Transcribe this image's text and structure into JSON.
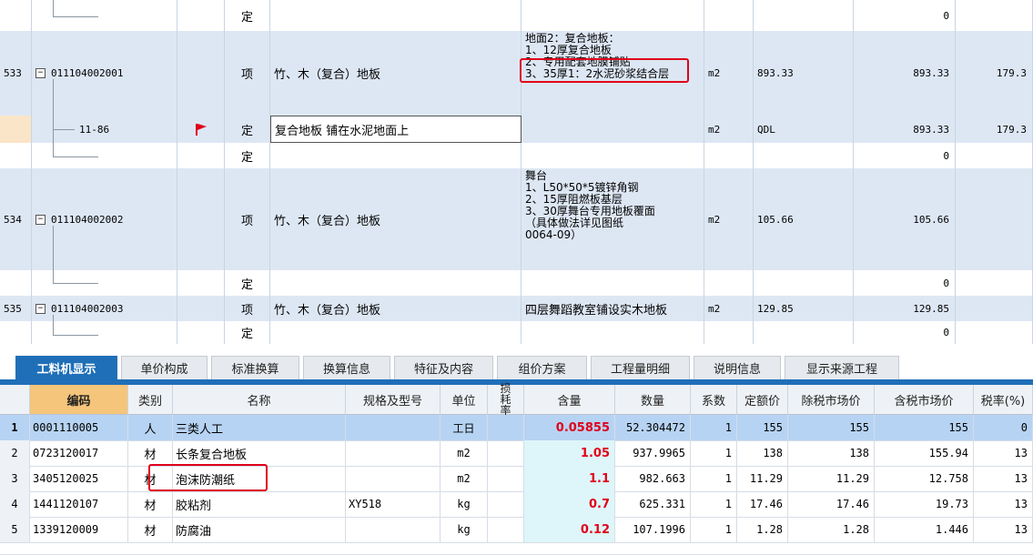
{
  "top": {
    "type_label": "定",
    "row_dinge_empty_qty": "0",
    "row533": {
      "num": "533",
      "code": "011104002001",
      "kind": "项",
      "name": "竹、木（复合）地板",
      "desc_lines": [
        "地面2：复合地板：",
        "1、12厚复合地板",
        "2、专用配套地膜铺贴",
        "3、35厚1：2水泥砂浆结合层"
      ],
      "unit": "m2",
      "expr": "893.33",
      "qty": "893.33",
      "price": "179.3"
    },
    "row_sel": {
      "code": "11-86",
      "kind": "定",
      "name": "复合地板 铺在水泥地面上",
      "unit": "m2",
      "expr": "QDL",
      "qty": "893.33",
      "price": "179.3"
    },
    "row534": {
      "num": "534",
      "code": "011104002002",
      "kind": "项",
      "name": "竹、木（复合）地板",
      "desc_lines": [
        "舞台",
        "1、L50*50*5镀锌角钢",
        "2、15厚阻燃板基层",
        "3、30厚舞台专用地板覆面",
        "（具体做法详见图纸",
        "0064-09）"
      ],
      "unit": "m2",
      "expr": "105.66",
      "qty": "105.66"
    },
    "row535": {
      "num": "535",
      "code": "011104002003",
      "kind": "项",
      "name": "竹、木（复合）地板",
      "desc": "四层舞蹈教室铺设实木地板",
      "unit": "m2",
      "expr": "129.85",
      "qty": "129.85"
    },
    "tree_toggle": "−"
  },
  "tabs": [
    "工料机显示",
    "单价构成",
    "标准换算",
    "换算信息",
    "特征及内容",
    "组价方案",
    "工程量明细",
    "说明信息",
    "显示来源工程"
  ],
  "bottom": {
    "headers": [
      "编码",
      "类别",
      "名称",
      "规格及型号",
      "单位",
      "损耗率",
      "含量",
      "数量",
      "系数",
      "定额价",
      "除税市场价",
      "含税市场价",
      "税率(%)"
    ],
    "rows": [
      {
        "n": "1",
        "code": "0001110005",
        "cat": "人",
        "name": "三类人工",
        "spec": "",
        "unit": "工日",
        "content": "0.05855",
        "amount": "52.304472",
        "coef": "1",
        "base": "155",
        "ex": "155",
        "inc": "155",
        "tax": "0"
      },
      {
        "n": "2",
        "code": "0723120017",
        "cat": "材",
        "name": "长条复合地板",
        "spec": "",
        "unit": "m2",
        "content": "1.05",
        "amount": "937.9965",
        "coef": "1",
        "base": "138",
        "ex": "138",
        "inc": "155.94",
        "tax": "13"
      },
      {
        "n": "3",
        "code": "3405120025",
        "cat": "材",
        "name": "泡沫防潮纸",
        "spec": "",
        "unit": "m2",
        "content": "1.1",
        "amount": "982.663",
        "coef": "1",
        "base": "11.29",
        "ex": "11.29",
        "inc": "12.758",
        "tax": "13"
      },
      {
        "n": "4",
        "code": "1441120107",
        "cat": "材",
        "name": "胶粘剂",
        "spec": "XY518",
        "unit": "kg",
        "content": "0.7",
        "amount": "625.331",
        "coef": "1",
        "base": "17.46",
        "ex": "17.46",
        "inc": "19.73",
        "tax": "13"
      },
      {
        "n": "5",
        "code": "1339120009",
        "cat": "材",
        "name": "防腐油",
        "spec": "",
        "unit": "kg",
        "content": "0.12",
        "amount": "107.1996",
        "coef": "1",
        "base": "1.28",
        "ex": "1.28",
        "inc": "1.446",
        "tax": "13"
      }
    ]
  },
  "colors": {
    "accent": "#1f6fb8",
    "highlight_row": "#b7d3f3",
    "red": "#e0001a",
    "flag": "#e0001a"
  }
}
